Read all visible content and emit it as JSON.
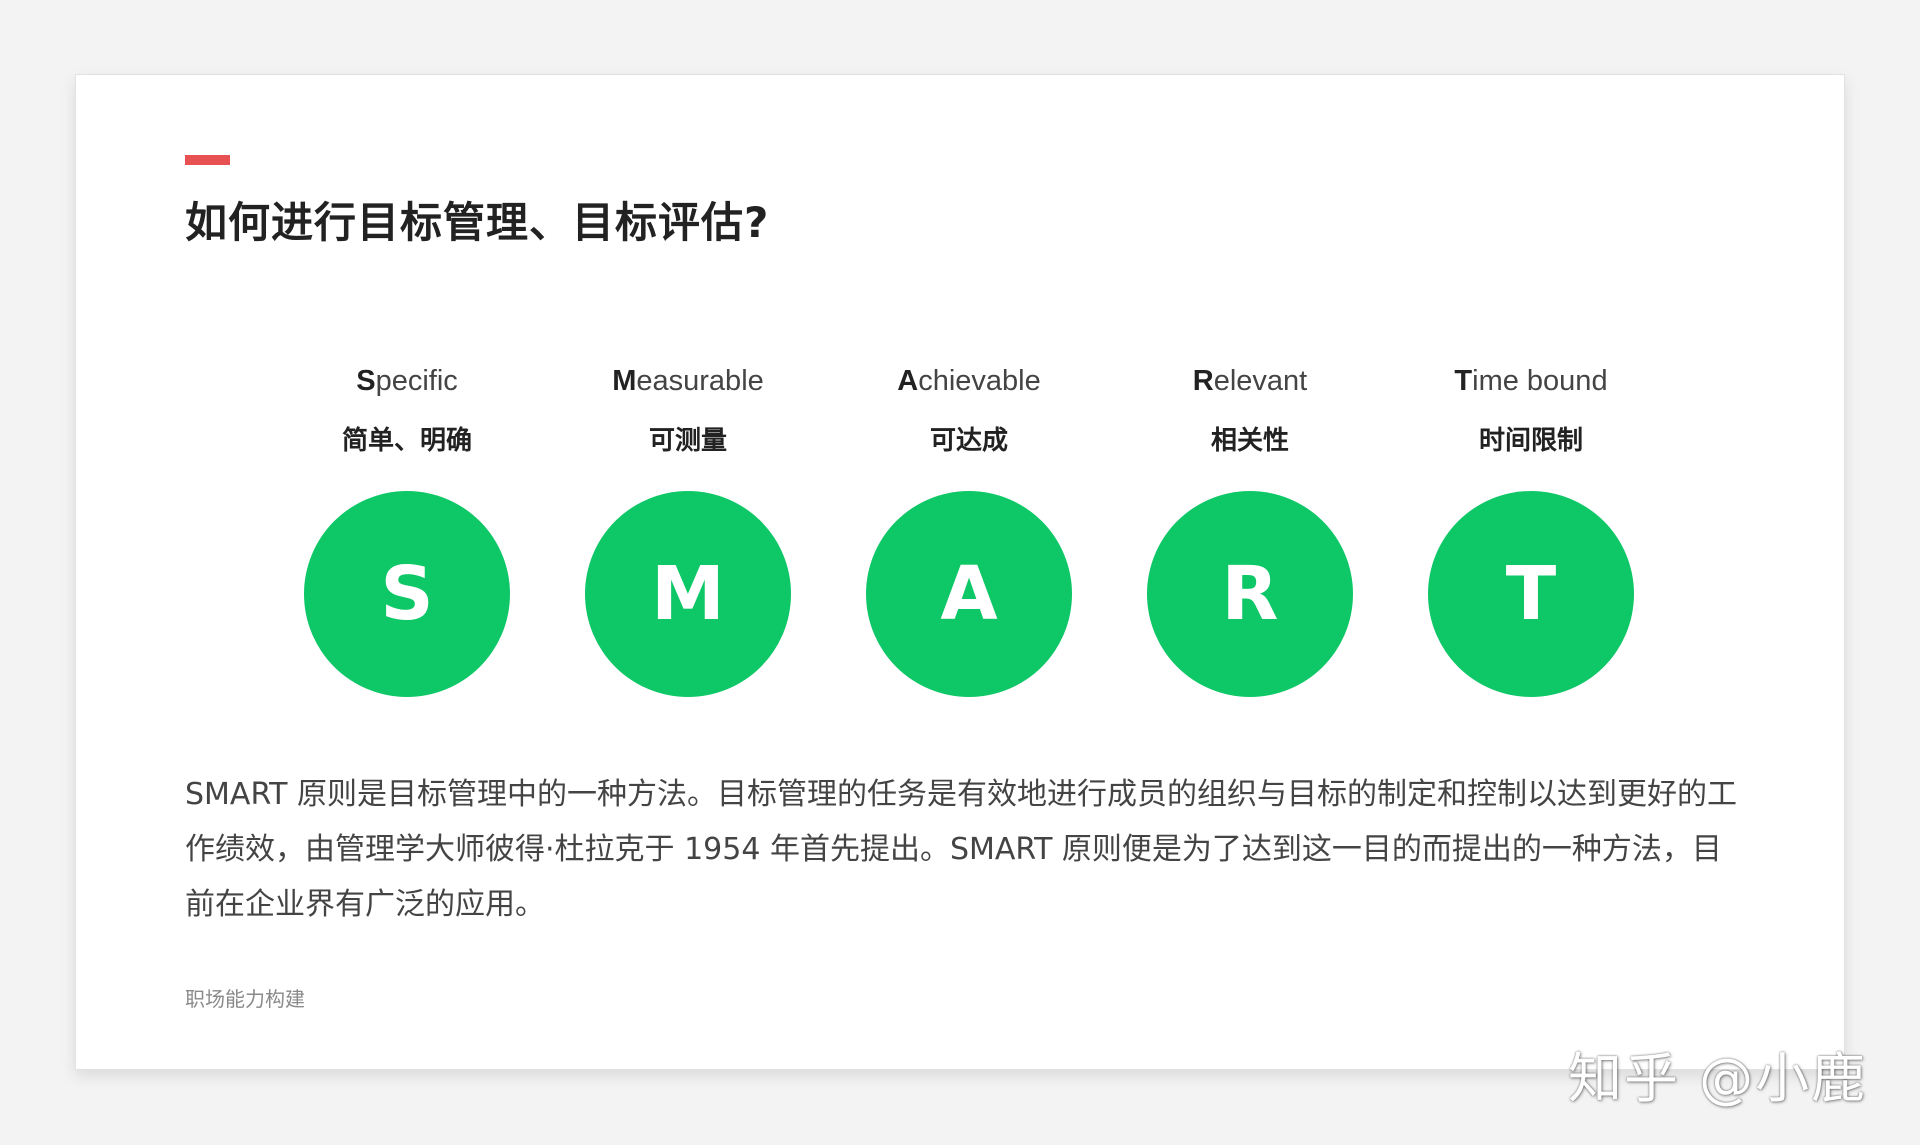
{
  "slide": {
    "title": "如何进行目标管理、目标评估?",
    "description": "SMART 原则是目标管理中的一种方法。目标管理的任务是有效地进行成员的组织与目标的制定和控制以达到更好的工作绩效，由管理学大师彼得·杜拉克于 1954 年首先提出。SMART 原则便是为了达到这一目的而提出的一种方法，目前在企业界有广泛的应用。",
    "footer": "职场能力构建",
    "accent_color": "#e85151",
    "circle_color": "#0ec767"
  },
  "smart": [
    {
      "initial": "S",
      "rest": "pecific",
      "cn": "简单、明确",
      "letter": "S"
    },
    {
      "initial": "M",
      "rest": "easurable",
      "cn": "可测量",
      "letter": "M"
    },
    {
      "initial": "A",
      "rest": "chievable",
      "cn": "可达成",
      "letter": "A"
    },
    {
      "initial": "R",
      "rest": "elevant",
      "cn": "相关性",
      "letter": "R"
    },
    {
      "initial": "T",
      "rest": "ime bound",
      "cn": "时间限制",
      "letter": "T"
    }
  ],
  "watermark": {
    "text": "知乎 @小鹿"
  }
}
